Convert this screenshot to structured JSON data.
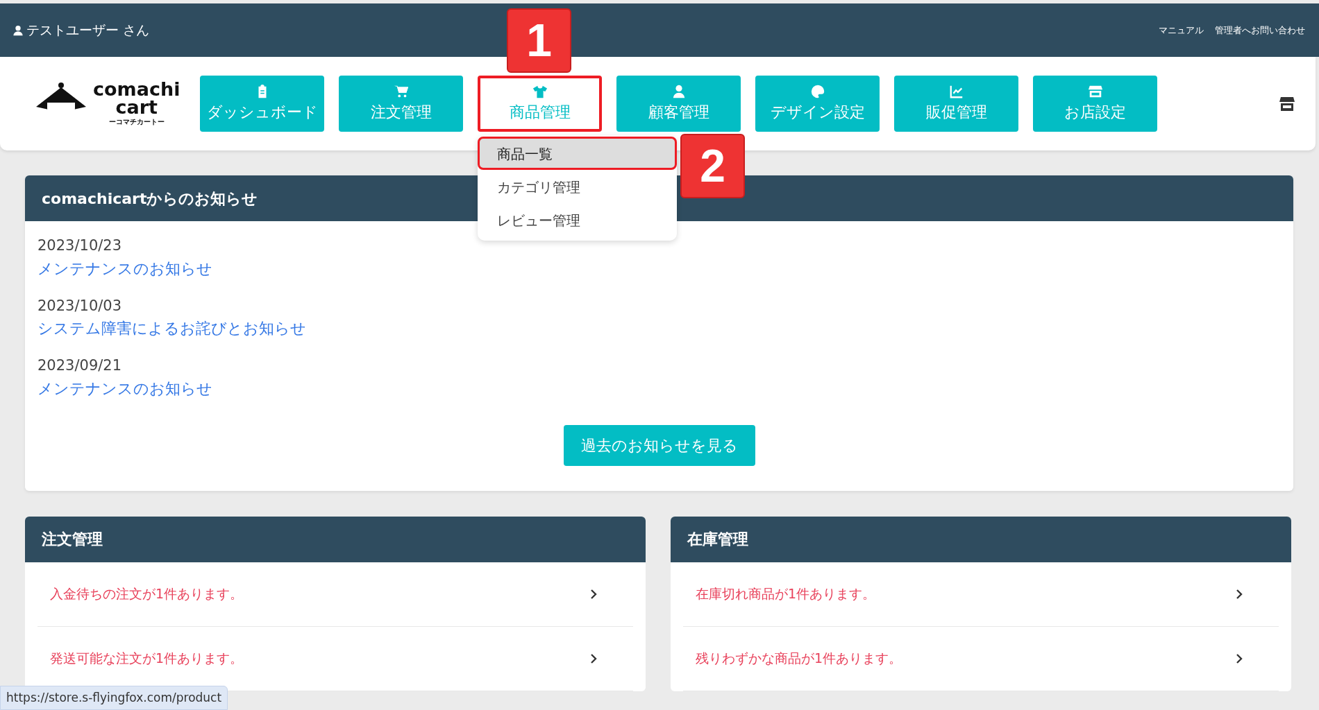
{
  "top_bar": {
    "user": "テストユーザー さん",
    "links": [
      "マニュアル",
      "管理者へお問い合わせ"
    ]
  },
  "logo": {
    "name": "comachi",
    "name2": "cart",
    "tagline": "ーコマチカートー"
  },
  "nav": [
    {
      "label": "ダッシュボード",
      "selected": false
    },
    {
      "label": "注文管理",
      "selected": false
    },
    {
      "label": "商品管理",
      "selected": true
    },
    {
      "label": "顧客管理",
      "selected": false
    },
    {
      "label": "デザイン設定",
      "selected": false
    },
    {
      "label": "販促管理",
      "selected": false
    },
    {
      "label": "お店設定",
      "selected": false
    }
  ],
  "dropdown": [
    {
      "label": "商品一覧",
      "highlighted": true
    },
    {
      "label": "カテゴリ管理",
      "highlighted": false
    },
    {
      "label": "レビュー管理",
      "highlighted": false
    }
  ],
  "annotations": [
    "1",
    "2"
  ],
  "notices": {
    "title": "comachicartからのお知らせ",
    "items": [
      {
        "date": "2023/10/23",
        "title": "メンテナンスのお知らせ"
      },
      {
        "date": "2023/10/03",
        "title": "システム障害によるお詫びとお知らせ"
      },
      {
        "date": "2023/09/21",
        "title": "メンテナンスのお知らせ"
      }
    ],
    "button": "過去のお知らせを見る"
  },
  "panels": [
    {
      "title": "注文管理",
      "alerts": [
        "入金待ちの注文が1件あります。",
        "発送可能な注文が1件あります。"
      ]
    },
    {
      "title": "在庫管理",
      "alerts": [
        "在庫切れ商品が1件あります。",
        "残りわずかな商品が1件あります。"
      ]
    }
  ],
  "status_bar": {
    "url": "https://store.s-flyingfox.com/product"
  }
}
